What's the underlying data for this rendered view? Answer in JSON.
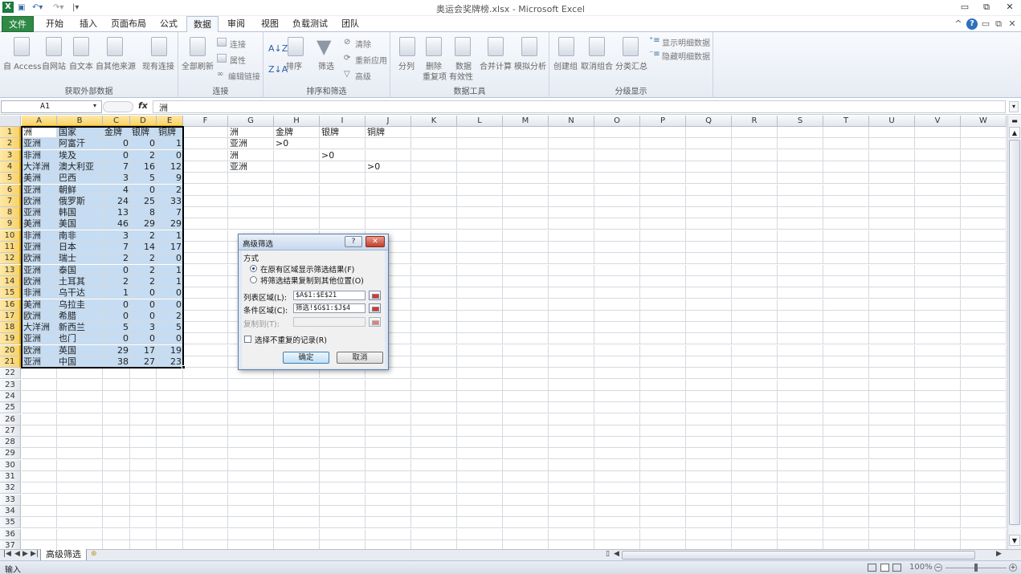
{
  "window": {
    "title": "奥运会奖牌榜.xlsx - Microsoft Excel",
    "minimize": "▭",
    "restore": "⧉",
    "close": "✕"
  },
  "tabs": [
    "文件",
    "开始",
    "插入",
    "页面布局",
    "公式",
    "数据",
    "审阅",
    "视图",
    "负载测试",
    "团队"
  ],
  "active_tab": "数据",
  "ribbon": {
    "get_external": {
      "label": "获取外部数据",
      "items": [
        "自 Access",
        "自网站",
        "自文本",
        "自其他来源",
        "现有连接"
      ]
    },
    "connections": {
      "label": "连接",
      "refresh": "全部刷新",
      "items": [
        "连接",
        "属性",
        "编辑链接"
      ]
    },
    "sort_filter": {
      "label": "排序和筛选",
      "sort": "排序",
      "filter": "筛选",
      "items": [
        "清除",
        "重新应用",
        "高级"
      ]
    },
    "data_tools": {
      "label": "数据工具",
      "split": "分列",
      "dedupe": [
        "删除",
        "重复项"
      ],
      "validation": [
        "数据",
        "有效性"
      ],
      "consolidate": "合并计算",
      "whatif": "模拟分析"
    },
    "outline": {
      "label": "分级显示",
      "group": "创建组",
      "ungroup": "取消组合",
      "subtotal": "分类汇总",
      "items": [
        "显示明细数据",
        "隐藏明细数据"
      ]
    }
  },
  "formula_bar": {
    "name_box": "A1",
    "fx": "fx",
    "value": "洲"
  },
  "columns": [
    "A",
    "B",
    "C",
    "D",
    "E",
    "F",
    "G",
    "H",
    "I",
    "J",
    "K",
    "L",
    "M",
    "N",
    "O",
    "P",
    "Q",
    "R",
    "S",
    "T",
    "U",
    "V",
    "W"
  ],
  "rows": [
    "1",
    "2",
    "3",
    "4",
    "5",
    "6",
    "7",
    "8",
    "9",
    "10",
    "11",
    "12",
    "13",
    "14",
    "15",
    "16",
    "17",
    "18",
    "19",
    "20",
    "21",
    "22",
    "23",
    "24",
    "25",
    "26",
    "27",
    "28",
    "29",
    "30",
    "31",
    "32",
    "33",
    "34",
    "35",
    "36",
    "37"
  ],
  "table": [
    [
      "洲",
      "国家",
      "金牌",
      "银牌",
      "铜牌"
    ],
    [
      "亚洲",
      "阿富汗",
      "0",
      "0",
      "1"
    ],
    [
      "非洲",
      "埃及",
      "0",
      "2",
      "0"
    ],
    [
      "大洋洲",
      "澳大利亚",
      "7",
      "16",
      "12"
    ],
    [
      "美洲",
      "巴西",
      "3",
      "5",
      "9"
    ],
    [
      "亚洲",
      "朝鲜",
      "4",
      "0",
      "2"
    ],
    [
      "欧洲",
      "俄罗斯",
      "24",
      "25",
      "33"
    ],
    [
      "亚洲",
      "韩国",
      "13",
      "8",
      "7"
    ],
    [
      "美洲",
      "美国",
      "46",
      "29",
      "29"
    ],
    [
      "非洲",
      "南非",
      "3",
      "2",
      "1"
    ],
    [
      "亚洲",
      "日本",
      "7",
      "14",
      "17"
    ],
    [
      "欧洲",
      "瑞士",
      "2",
      "2",
      "0"
    ],
    [
      "亚洲",
      "泰国",
      "0",
      "2",
      "1"
    ],
    [
      "欧洲",
      "土耳其",
      "2",
      "2",
      "1"
    ],
    [
      "非洲",
      "乌干达",
      "1",
      "0",
      "0"
    ],
    [
      "美洲",
      "乌拉圭",
      "0",
      "0",
      "0"
    ],
    [
      "欧洲",
      "希腊",
      "0",
      "0",
      "2"
    ],
    [
      "大洋洲",
      "新西兰",
      "5",
      "3",
      "5"
    ],
    [
      "亚洲",
      "也门",
      "0",
      "0",
      "0"
    ],
    [
      "欧洲",
      "英国",
      "29",
      "17",
      "19"
    ],
    [
      "亚洲",
      "中国",
      "38",
      "27",
      "23"
    ]
  ],
  "criteria": [
    [
      "洲",
      "金牌",
      "银牌",
      "铜牌"
    ],
    [
      "亚洲",
      ">0",
      "",
      ""
    ],
    [
      "洲",
      "",
      ">0",
      ""
    ],
    [
      "亚洲",
      "",
      "",
      ">0"
    ]
  ],
  "dialog": {
    "title": "高级筛选",
    "help": "?",
    "close": "✕",
    "section": "方式",
    "opt1": "在原有区域显示筛选结果(F)",
    "opt2": "将筛选结果复制到其他位置(O)",
    "list_label": "列表区域(L):",
    "list_value": "$A$1:$E$21",
    "crit_label": "条件区域(C):",
    "crit_value": "筛选!$G$1:$J$4",
    "copy_label": "复制到(T):",
    "copy_value": "",
    "unique": "选择不重复的记录(R)",
    "ok": "确定",
    "cancel": "取消"
  },
  "sheet_tab": "高级筛选",
  "status": {
    "mode": "输入",
    "zoom": "100%"
  }
}
